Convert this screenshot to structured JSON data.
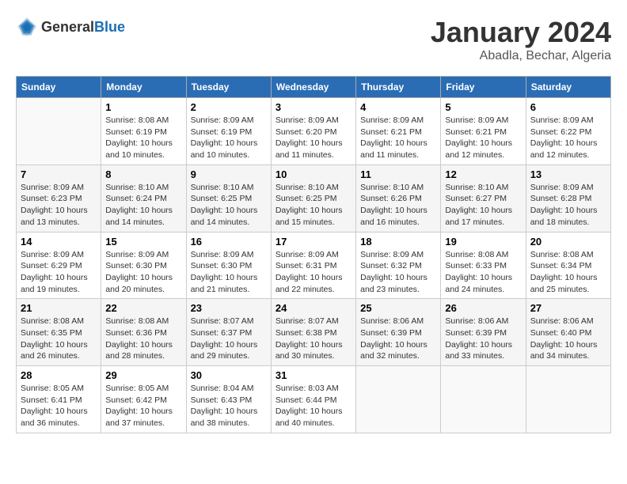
{
  "header": {
    "logo_general": "General",
    "logo_blue": "Blue",
    "month": "January 2024",
    "location": "Abadla, Bechar, Algeria"
  },
  "weekdays": [
    "Sunday",
    "Monday",
    "Tuesday",
    "Wednesday",
    "Thursday",
    "Friday",
    "Saturday"
  ],
  "weeks": [
    [
      {
        "day": "",
        "sunrise": "",
        "sunset": "",
        "daylight": ""
      },
      {
        "day": "1",
        "sunrise": "Sunrise: 8:08 AM",
        "sunset": "Sunset: 6:19 PM",
        "daylight": "Daylight: 10 hours and 10 minutes."
      },
      {
        "day": "2",
        "sunrise": "Sunrise: 8:09 AM",
        "sunset": "Sunset: 6:19 PM",
        "daylight": "Daylight: 10 hours and 10 minutes."
      },
      {
        "day": "3",
        "sunrise": "Sunrise: 8:09 AM",
        "sunset": "Sunset: 6:20 PM",
        "daylight": "Daylight: 10 hours and 11 minutes."
      },
      {
        "day": "4",
        "sunrise": "Sunrise: 8:09 AM",
        "sunset": "Sunset: 6:21 PM",
        "daylight": "Daylight: 10 hours and 11 minutes."
      },
      {
        "day": "5",
        "sunrise": "Sunrise: 8:09 AM",
        "sunset": "Sunset: 6:21 PM",
        "daylight": "Daylight: 10 hours and 12 minutes."
      },
      {
        "day": "6",
        "sunrise": "Sunrise: 8:09 AM",
        "sunset": "Sunset: 6:22 PM",
        "daylight": "Daylight: 10 hours and 12 minutes."
      }
    ],
    [
      {
        "day": "7",
        "sunrise": "Sunrise: 8:09 AM",
        "sunset": "Sunset: 6:23 PM",
        "daylight": "Daylight: 10 hours and 13 minutes."
      },
      {
        "day": "8",
        "sunrise": "Sunrise: 8:10 AM",
        "sunset": "Sunset: 6:24 PM",
        "daylight": "Daylight: 10 hours and 14 minutes."
      },
      {
        "day": "9",
        "sunrise": "Sunrise: 8:10 AM",
        "sunset": "Sunset: 6:25 PM",
        "daylight": "Daylight: 10 hours and 14 minutes."
      },
      {
        "day": "10",
        "sunrise": "Sunrise: 8:10 AM",
        "sunset": "Sunset: 6:25 PM",
        "daylight": "Daylight: 10 hours and 15 minutes."
      },
      {
        "day": "11",
        "sunrise": "Sunrise: 8:10 AM",
        "sunset": "Sunset: 6:26 PM",
        "daylight": "Daylight: 10 hours and 16 minutes."
      },
      {
        "day": "12",
        "sunrise": "Sunrise: 8:10 AM",
        "sunset": "Sunset: 6:27 PM",
        "daylight": "Daylight: 10 hours and 17 minutes."
      },
      {
        "day": "13",
        "sunrise": "Sunrise: 8:09 AM",
        "sunset": "Sunset: 6:28 PM",
        "daylight": "Daylight: 10 hours and 18 minutes."
      }
    ],
    [
      {
        "day": "14",
        "sunrise": "Sunrise: 8:09 AM",
        "sunset": "Sunset: 6:29 PM",
        "daylight": "Daylight: 10 hours and 19 minutes."
      },
      {
        "day": "15",
        "sunrise": "Sunrise: 8:09 AM",
        "sunset": "Sunset: 6:30 PM",
        "daylight": "Daylight: 10 hours and 20 minutes."
      },
      {
        "day": "16",
        "sunrise": "Sunrise: 8:09 AM",
        "sunset": "Sunset: 6:30 PM",
        "daylight": "Daylight: 10 hours and 21 minutes."
      },
      {
        "day": "17",
        "sunrise": "Sunrise: 8:09 AM",
        "sunset": "Sunset: 6:31 PM",
        "daylight": "Daylight: 10 hours and 22 minutes."
      },
      {
        "day": "18",
        "sunrise": "Sunrise: 8:09 AM",
        "sunset": "Sunset: 6:32 PM",
        "daylight": "Daylight: 10 hours and 23 minutes."
      },
      {
        "day": "19",
        "sunrise": "Sunrise: 8:08 AM",
        "sunset": "Sunset: 6:33 PM",
        "daylight": "Daylight: 10 hours and 24 minutes."
      },
      {
        "day": "20",
        "sunrise": "Sunrise: 8:08 AM",
        "sunset": "Sunset: 6:34 PM",
        "daylight": "Daylight: 10 hours and 25 minutes."
      }
    ],
    [
      {
        "day": "21",
        "sunrise": "Sunrise: 8:08 AM",
        "sunset": "Sunset: 6:35 PM",
        "daylight": "Daylight: 10 hours and 26 minutes."
      },
      {
        "day": "22",
        "sunrise": "Sunrise: 8:08 AM",
        "sunset": "Sunset: 6:36 PM",
        "daylight": "Daylight: 10 hours and 28 minutes."
      },
      {
        "day": "23",
        "sunrise": "Sunrise: 8:07 AM",
        "sunset": "Sunset: 6:37 PM",
        "daylight": "Daylight: 10 hours and 29 minutes."
      },
      {
        "day": "24",
        "sunrise": "Sunrise: 8:07 AM",
        "sunset": "Sunset: 6:38 PM",
        "daylight": "Daylight: 10 hours and 30 minutes."
      },
      {
        "day": "25",
        "sunrise": "Sunrise: 8:06 AM",
        "sunset": "Sunset: 6:39 PM",
        "daylight": "Daylight: 10 hours and 32 minutes."
      },
      {
        "day": "26",
        "sunrise": "Sunrise: 8:06 AM",
        "sunset": "Sunset: 6:39 PM",
        "daylight": "Daylight: 10 hours and 33 minutes."
      },
      {
        "day": "27",
        "sunrise": "Sunrise: 8:06 AM",
        "sunset": "Sunset: 6:40 PM",
        "daylight": "Daylight: 10 hours and 34 minutes."
      }
    ],
    [
      {
        "day": "28",
        "sunrise": "Sunrise: 8:05 AM",
        "sunset": "Sunset: 6:41 PM",
        "daylight": "Daylight: 10 hours and 36 minutes."
      },
      {
        "day": "29",
        "sunrise": "Sunrise: 8:05 AM",
        "sunset": "Sunset: 6:42 PM",
        "daylight": "Daylight: 10 hours and 37 minutes."
      },
      {
        "day": "30",
        "sunrise": "Sunrise: 8:04 AM",
        "sunset": "Sunset: 6:43 PM",
        "daylight": "Daylight: 10 hours and 38 minutes."
      },
      {
        "day": "31",
        "sunrise": "Sunrise: 8:03 AM",
        "sunset": "Sunset: 6:44 PM",
        "daylight": "Daylight: 10 hours and 40 minutes."
      },
      {
        "day": "",
        "sunrise": "",
        "sunset": "",
        "daylight": ""
      },
      {
        "day": "",
        "sunrise": "",
        "sunset": "",
        "daylight": ""
      },
      {
        "day": "",
        "sunrise": "",
        "sunset": "",
        "daylight": ""
      }
    ]
  ]
}
